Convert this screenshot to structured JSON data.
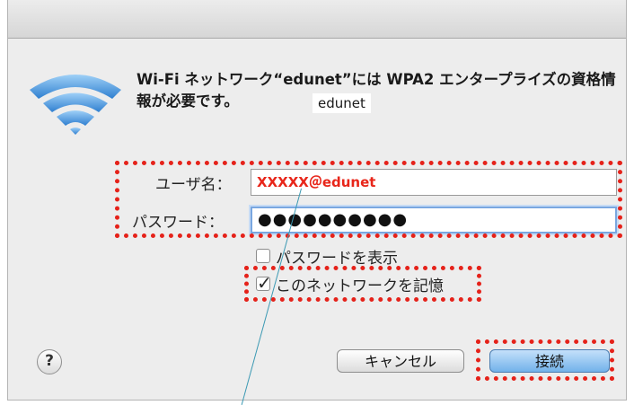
{
  "dialog": {
    "message": "Wi-Fi ネットワーク“edunet”には WPA2 エンタープライズの資格情報が必要です。",
    "ssid_overlay": "edunet",
    "username_label": "ユーザ名：",
    "username_value": "XXXXX＠edunet",
    "password_label": "パスワード：",
    "password_value": "●●●●●●●●●●",
    "show_password_label": "パスワードを表示",
    "show_password_checked": false,
    "remember_label": "このネットワークを記憶",
    "remember_checked": true,
    "help_label": "?",
    "cancel_label": "キャンセル",
    "connect_label": "接続"
  },
  "colors": {
    "highlight": "#e5221a",
    "primary_button": "#72b2ea",
    "wifi_icon": "#4f9ee3"
  },
  "icons": [
    "wifi-icon",
    "help-icon",
    "checkmark-icon"
  ]
}
